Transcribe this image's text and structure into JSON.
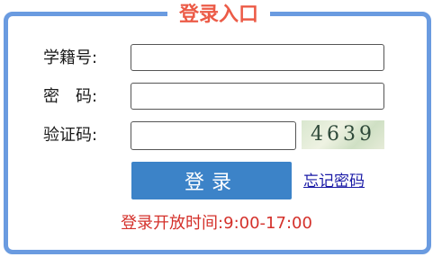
{
  "panel": {
    "title": "登录入口"
  },
  "form": {
    "student_id_label": "学籍号:",
    "password_label": "密　码:",
    "captcha_label": "验证码:",
    "student_id_value": "",
    "password_value": "",
    "captcha_value": "",
    "captcha_image_text": "4639"
  },
  "actions": {
    "login_label": "登录",
    "forgot_label": "忘记密码"
  },
  "notice": {
    "hours": "登录开放时间:9:00-17:00"
  },
  "colors": {
    "frame": "#6a9be0",
    "title": "#ec5b47",
    "button": "#3c83c8",
    "notice": "#d4312b"
  }
}
